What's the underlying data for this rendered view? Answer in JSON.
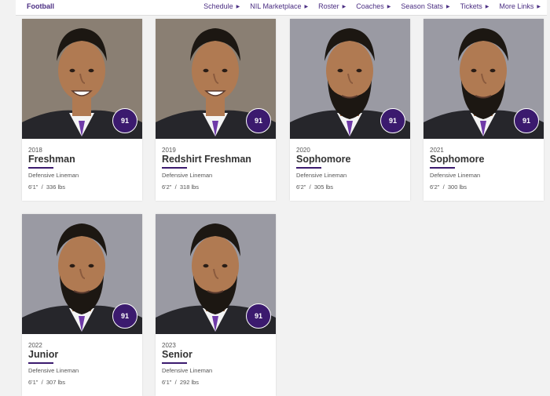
{
  "nav": {
    "brand": "Football",
    "links": [
      "Schedule",
      "NIL Marketplace",
      "Roster",
      "Coaches",
      "Season Stats",
      "Tickets",
      "More Links"
    ]
  },
  "player": {
    "number": "91"
  },
  "cards": [
    {
      "year": "2018",
      "class": "Freshman",
      "position": "Defensive Lineman",
      "height": "6'1\"",
      "weight": "336 lbs",
      "bearded": false
    },
    {
      "year": "2019",
      "class": "Redshirt Freshman",
      "position": "Defensive Lineman",
      "height": "6'2\"",
      "weight": "318 lbs",
      "bearded": false
    },
    {
      "year": "2020",
      "class": "Sophomore",
      "position": "Defensive Lineman",
      "height": "6'2\"",
      "weight": "305 lbs",
      "bearded": true
    },
    {
      "year": "2021",
      "class": "Sophomore",
      "position": "Defensive Lineman",
      "height": "6'2\"",
      "weight": "300 lbs",
      "bearded": true
    },
    {
      "year": "2022",
      "class": "Junior",
      "position": "Defensive Lineman",
      "height": "6'1\"",
      "weight": "307 lbs",
      "bearded": true
    },
    {
      "year": "2023",
      "class": "Senior",
      "position": "Defensive Lineman",
      "height": "6'1\"",
      "weight": "292 lbs",
      "bearded": true
    }
  ],
  "stats_separator": "/",
  "colors": {
    "accent": "#3b1a6e",
    "brand": "#4b2e83"
  }
}
